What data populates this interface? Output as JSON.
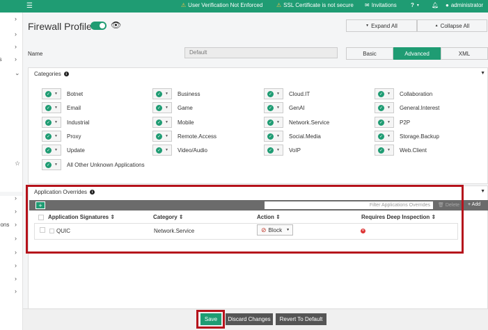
{
  "topbar": {
    "warning_verification": "User Verification Not Enforced",
    "warning_ssl": "SSL Certificate is not secure",
    "invitations": "Invitations",
    "help": "?",
    "user": "administrator"
  },
  "leftnav": {
    "labels": [
      "nts",
      "ations"
    ]
  },
  "header": {
    "title": "Firewall Profile",
    "enabled": true,
    "expand_all": "Expand All",
    "collapse_all": "Collapse All"
  },
  "name_row": {
    "label": "Name",
    "placeholder": "Default"
  },
  "modes": {
    "basic": "Basic",
    "advanced": "Advanced",
    "xml": "XML",
    "selected": "Advanced"
  },
  "categories": {
    "title": "Categories",
    "items": [
      "Botnet",
      "Business",
      "Cloud.IT",
      "Collaboration",
      "Email",
      "Game",
      "GenAI",
      "General.Interest",
      "Industrial",
      "Mobile",
      "Network.Service",
      "P2P",
      "Proxy",
      "Remote.Access",
      "Social.Media",
      "Storage.Backup",
      "Update",
      "Video/Audio",
      "VoIP",
      "Web.Client",
      "All Other Unknown Applications"
    ]
  },
  "overrides": {
    "title": "Application Overrides",
    "filter_placeholder": "Filter Applications Overrides",
    "delete_label": "Delete",
    "add_label": "Add",
    "columns": [
      "Application Signatures",
      "Category",
      "Action",
      "Requires Deep Inspection"
    ],
    "rows": [
      {
        "signature": "QUIC",
        "category": "Network.Service",
        "action": "Block"
      }
    ]
  },
  "footer": {
    "save": "Save",
    "discard": "Discard Changes",
    "revert": "Revert To Default"
  },
  "colors": {
    "accent": "#1f9c73",
    "highlight": "#b5121b"
  }
}
